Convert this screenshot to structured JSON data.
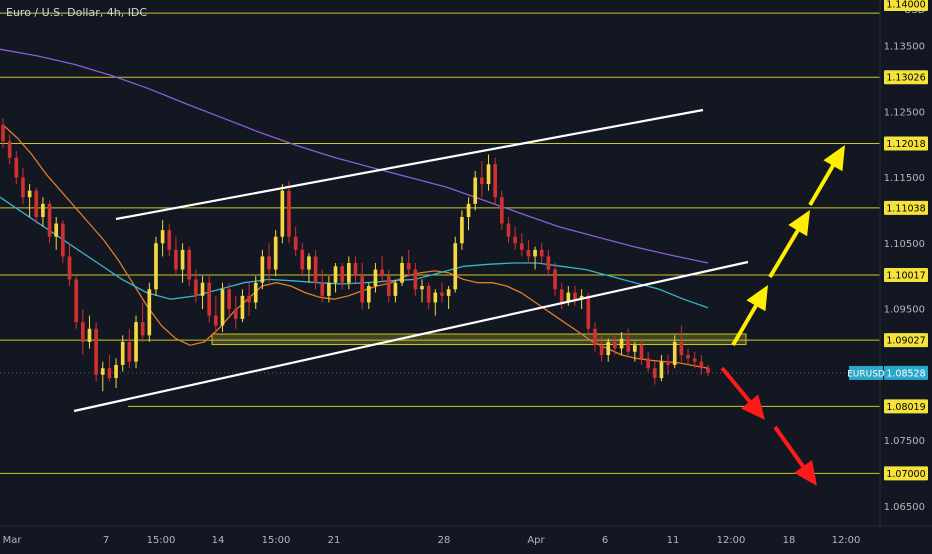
{
  "header": {
    "title": "Euro / U.S. Dollar, 4h, IDC"
  },
  "axis": {
    "currency": "USD",
    "price_ticks": [
      "1.13500",
      "1.12500",
      "1.11500",
      "1.10500",
      "1.09500",
      "1.08500",
      "1.07500",
      "1.06500"
    ],
    "date_ticks": [
      "Mar",
      "7",
      "15:00",
      "14",
      "15:00",
      "21",
      "28",
      "Apr",
      "6",
      "11",
      "12:00",
      "18",
      "12:00"
    ]
  },
  "levels": [
    "1.13026",
    "1.12018",
    "1.11038",
    "1.10017",
    "1.09027",
    "1.08019",
    "1.07000"
  ],
  "top_level_label": "1.14000",
  "current_price": {
    "symbol": "EURUSD",
    "value": "1.08528"
  },
  "colors": {
    "background": "#131722",
    "up": "#f5d742",
    "down": "#d03030",
    "level": "#c9c62b",
    "ma_fast": "#e07b2a",
    "ma_mid": "#35b6c9",
    "ma_slow": "#8660d6",
    "trendline": "#ffffff",
    "arrow_up": "#ffee00",
    "arrow_down": "#ff1a1a",
    "price_box": "#f5e33b",
    "current_box": "#29a8c9"
  },
  "chart_data": {
    "type": "candlestick",
    "title": "Euro / U.S. Dollar, 4h, IDC",
    "ylim": [
      1.062,
      1.142
    ],
    "horizontal_levels": [
      1.14,
      1.13026,
      1.12018,
      1.11038,
      1.10017,
      1.09027,
      1.08019,
      1.07
    ],
    "current_price": 1.08528,
    "candles": [
      [
        1.123,
        1.124,
        1.1195,
        1.1205
      ],
      [
        1.1205,
        1.1215,
        1.117,
        1.118
      ],
      [
        1.118,
        1.119,
        1.114,
        1.115
      ],
      [
        1.115,
        1.1165,
        1.111,
        1.112
      ],
      [
        1.112,
        1.114,
        1.109,
        1.113
      ],
      [
        1.113,
        1.1135,
        1.108,
        1.109
      ],
      [
        1.109,
        1.112,
        1.1075,
        1.111
      ],
      [
        1.111,
        1.1115,
        1.105,
        1.106
      ],
      [
        1.106,
        1.109,
        1.104,
        1.108
      ],
      [
        1.108,
        1.1085,
        1.102,
        1.103
      ],
      [
        1.103,
        1.105,
        1.0985,
        1.0995
      ],
      [
        1.0995,
        1.1,
        1.092,
        1.093
      ],
      [
        1.093,
        1.095,
        1.088,
        1.09
      ],
      [
        1.09,
        1.094,
        1.089,
        1.092
      ],
      [
        1.092,
        1.093,
        1.084,
        1.085
      ],
      [
        1.085,
        1.087,
        1.0825,
        1.086
      ],
      [
        1.086,
        1.088,
        1.084,
        1.0845
      ],
      [
        1.0845,
        1.0875,
        1.083,
        1.0865
      ],
      [
        1.0865,
        1.091,
        1.0855,
        1.09
      ],
      [
        1.09,
        1.092,
        1.086,
        1.087
      ],
      [
        1.087,
        1.094,
        1.086,
        1.093
      ],
      [
        1.093,
        1.096,
        1.09,
        1.091
      ],
      [
        1.091,
        1.099,
        1.09,
        1.098
      ],
      [
        1.098,
        1.106,
        1.097,
        1.105
      ],
      [
        1.105,
        1.1085,
        1.103,
        1.107
      ],
      [
        1.107,
        1.108,
        1.103,
        1.104
      ],
      [
        1.104,
        1.106,
        1.1,
        1.101
      ],
      [
        1.101,
        1.105,
        1.099,
        1.104
      ],
      [
        1.104,
        1.1045,
        1.0985,
        1.0995
      ],
      [
        1.0995,
        1.101,
        1.096,
        1.097
      ],
      [
        1.097,
        1.1,
        1.095,
        1.099
      ],
      [
        1.099,
        1.1,
        1.093,
        1.094
      ],
      [
        1.094,
        1.097,
        1.091,
        1.0925
      ],
      [
        1.0925,
        1.099,
        1.0915,
        1.098
      ],
      [
        1.098,
        1.099,
        1.094,
        1.095
      ],
      [
        1.095,
        1.097,
        1.092,
        1.0935
      ],
      [
        1.0935,
        1.098,
        1.093,
        1.097
      ],
      [
        1.097,
        1.099,
        1.094,
        1.096
      ],
      [
        1.096,
        1.1,
        1.095,
        1.099
      ],
      [
        1.099,
        1.104,
        1.098,
        1.103
      ],
      [
        1.103,
        1.105,
        1.099,
        1.101
      ],
      [
        1.101,
        1.107,
        1.1,
        1.106
      ],
      [
        1.106,
        1.114,
        1.105,
        1.113
      ],
      [
        1.113,
        1.1145,
        1.105,
        1.106
      ],
      [
        1.106,
        1.1075,
        1.103,
        1.104
      ],
      [
        1.104,
        1.105,
        1.1,
        1.101
      ],
      [
        1.101,
        1.1035,
        1.099,
        1.103
      ],
      [
        1.103,
        1.104,
        1.098,
        1.099
      ],
      [
        1.099,
        1.101,
        1.096,
        1.097
      ],
      [
        1.097,
        1.1,
        1.096,
        1.099
      ],
      [
        1.099,
        1.102,
        1.0975,
        1.1015
      ],
      [
        1.1015,
        1.102,
        1.098,
        1.099
      ],
      [
        1.099,
        1.103,
        1.098,
        1.102
      ],
      [
        1.102,
        1.103,
        1.099,
        1.1
      ],
      [
        1.1,
        1.102,
        1.095,
        1.096
      ],
      [
        1.096,
        1.099,
        1.095,
        1.0985
      ],
      [
        1.0985,
        1.102,
        1.0975,
        1.101
      ],
      [
        1.101,
        1.103,
        1.099,
        1.1
      ],
      [
        1.1,
        1.101,
        1.096,
        1.097
      ],
      [
        1.097,
        1.0995,
        1.096,
        1.099
      ],
      [
        1.099,
        1.103,
        1.0985,
        1.102
      ],
      [
        1.102,
        1.104,
        1.1,
        1.101
      ],
      [
        1.101,
        1.102,
        1.097,
        1.098
      ],
      [
        1.098,
        1.0995,
        1.096,
        1.0985
      ],
      [
        1.0985,
        1.099,
        1.095,
        1.096
      ],
      [
        1.096,
        1.098,
        1.094,
        1.0975
      ],
      [
        1.0975,
        1.099,
        1.096,
        1.097
      ],
      [
        1.097,
        1.0985,
        1.095,
        1.098
      ],
      [
        1.098,
        1.106,
        1.0975,
        1.105
      ],
      [
        1.105,
        1.11,
        1.104,
        1.109
      ],
      [
        1.109,
        1.112,
        1.107,
        1.111
      ],
      [
        1.111,
        1.116,
        1.11,
        1.115
      ],
      [
        1.115,
        1.1175,
        1.112,
        1.114
      ],
      [
        1.114,
        1.1185,
        1.113,
        1.117
      ],
      [
        1.117,
        1.118,
        1.111,
        1.112
      ],
      [
        1.112,
        1.113,
        1.107,
        1.108
      ],
      [
        1.108,
        1.109,
        1.105,
        1.106
      ],
      [
        1.106,
        1.1075,
        1.104,
        1.105
      ],
      [
        1.105,
        1.1065,
        1.103,
        1.104
      ],
      [
        1.104,
        1.1055,
        1.102,
        1.103
      ],
      [
        1.103,
        1.1045,
        1.101,
        1.104
      ],
      [
        1.104,
        1.105,
        1.102,
        1.103
      ],
      [
        1.103,
        1.104,
        1.1,
        1.101
      ],
      [
        1.101,
        1.102,
        1.097,
        1.098
      ],
      [
        1.098,
        1.099,
        1.095,
        1.096
      ],
      [
        1.096,
        1.0985,
        1.0955,
        1.0975
      ],
      [
        1.0975,
        1.0985,
        1.0955,
        1.0965
      ],
      [
        1.0965,
        1.098,
        1.095,
        1.097
      ],
      [
        1.097,
        1.0975,
        1.091,
        1.092
      ],
      [
        1.092,
        1.093,
        1.0885,
        1.0895
      ],
      [
        1.0895,
        1.091,
        1.087,
        1.088
      ],
      [
        1.088,
        1.0905,
        1.087,
        1.09
      ],
      [
        1.09,
        1.091,
        1.088,
        1.089
      ],
      [
        1.089,
        1.0915,
        1.088,
        1.0905
      ],
      [
        1.0905,
        1.092,
        1.088,
        1.0885
      ],
      [
        1.0885,
        1.09,
        1.087,
        1.0895
      ],
      [
        1.0895,
        1.0905,
        1.0865,
        1.0875
      ],
      [
        1.0875,
        1.0885,
        1.0855,
        1.086
      ],
      [
        1.086,
        1.087,
        1.0835,
        1.0845
      ],
      [
        1.0845,
        1.088,
        1.084,
        1.087
      ],
      [
        1.087,
        1.088,
        1.085,
        1.0865
      ],
      [
        1.0865,
        1.091,
        1.086,
        1.09
      ],
      [
        1.09,
        1.0925,
        1.087,
        1.088
      ],
      [
        1.088,
        1.089,
        1.0865,
        1.0875
      ],
      [
        1.0875,
        1.0885,
        1.086,
        1.087
      ],
      [
        1.087,
        1.088,
        1.085,
        1.086
      ],
      [
        1.086,
        1.0865,
        1.0848,
        1.0853
      ]
    ],
    "moving_averages": [
      {
        "values": [
          1.123,
          1.121,
          1.1185,
          1.1155,
          1.113,
          1.1105,
          1.108,
          1.1055,
          1.1025,
          1.099,
          1.0955,
          1.0925,
          1.0905,
          1.0895,
          1.09,
          1.092,
          1.0945,
          1.0965,
          1.0985,
          1.099,
          1.0985,
          1.0975,
          1.0968,
          1.0965,
          1.097,
          1.0978,
          1.0985,
          1.099,
          1.1,
          1.1005,
          1.1008,
          1.1005,
          1.0995,
          1.099,
          1.099,
          1.0985,
          1.0975,
          1.096,
          1.0945,
          1.093,
          1.0915,
          1.09,
          1.089,
          1.088,
          1.0875,
          1.0872,
          1.087,
          1.0868,
          1.0864,
          1.086
        ]
      },
      {
        "values": [
          1.112,
          1.1095,
          1.107,
          1.1045,
          1.102,
          1.0995,
          1.0975,
          1.0965,
          1.097,
          1.098,
          1.099,
          1.0995,
          1.0993,
          1.099,
          1.0988,
          1.099,
          1.0993,
          1.0995,
          1.1005,
          1.1015,
          1.1018,
          1.102,
          1.102,
          1.1015,
          1.101,
          1.1,
          1.099,
          1.098,
          1.0965,
          1.0952
        ]
      },
      {
        "values": [
          1.1345,
          1.1335,
          1.1322,
          1.1305,
          1.1285,
          1.1262,
          1.124,
          1.1218,
          1.1198,
          1.118,
          1.1165,
          1.115,
          1.1135,
          1.1115,
          1.1095,
          1.1075,
          1.106,
          1.1045,
          1.1032,
          1.102
        ]
      }
    ]
  }
}
